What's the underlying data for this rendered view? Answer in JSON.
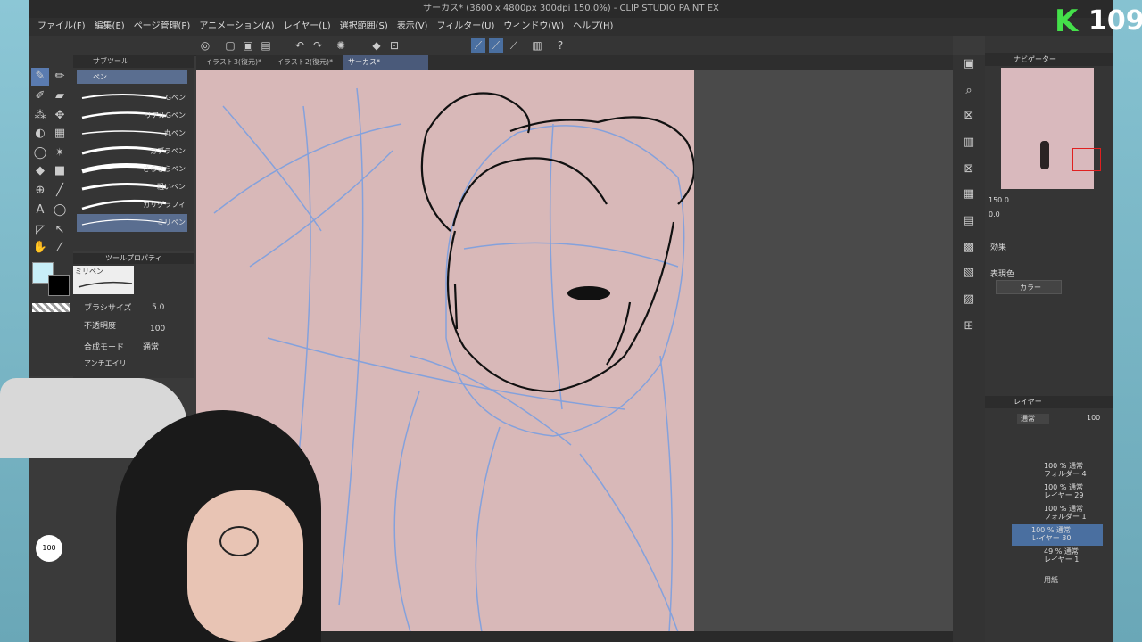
{
  "window": {
    "title": "サーカス* (3600 x 4800px 300dpi 150.0%)  - CLIP STUDIO PAINT EX"
  },
  "menu": [
    "ファイル(F)",
    "編集(E)",
    "ページ管理(P)",
    "アニメーション(A)",
    "レイヤー(L)",
    "選択範囲(S)",
    "表示(V)",
    "フィルター(U)",
    "ウィンドウ(W)",
    "ヘルプ(H)"
  ],
  "tabs": [
    {
      "label": "イラスト3(復元)*"
    },
    {
      "label": "イラスト2(復元)*"
    },
    {
      "label": "サーカス*",
      "active": true
    }
  ],
  "subtool": {
    "header": "サブツール",
    "group": "ペン",
    "brushes": [
      "Gペン",
      "リアルGペン",
      "丸ペン",
      "カブラペン",
      "さらさらペン",
      "粗いペン",
      "カリグラフィ",
      "ミリペン"
    ],
    "selected": "ミリペン"
  },
  "toolprop": {
    "header": "ツールプロパティ",
    "brush_name": "ミリペン",
    "brush_size_label": "ブラシサイズ",
    "brush_size": "5.0",
    "opacity_label": "不透明度",
    "opacity": "100",
    "blend_label": "合成モード",
    "blend": "通常",
    "aa_label": "アンチエイリ"
  },
  "navigator": {
    "header": "ナビゲーター",
    "zoom": "150.0",
    "rotate": "0.0"
  },
  "effects": {
    "header": "効果",
    "color_label": "表現色",
    "color_value": "カラー"
  },
  "layers": {
    "header": "レイヤー",
    "blend": "通常",
    "opacity": "100",
    "items": [
      {
        "line1": "100 % 通常",
        "line2": "フォルダー 4"
      },
      {
        "line1": "100 % 通常",
        "line2": "レイヤー 29"
      },
      {
        "line1": "100 % 通常",
        "line2": "フォルダー 1"
      },
      {
        "line1": "100 % 通常",
        "line2": "レイヤー 30",
        "active": true
      },
      {
        "line1": "49 % 通常",
        "line2": "レイヤー 1"
      },
      {
        "line1": "",
        "line2": "用紙"
      }
    ]
  },
  "colors": {
    "main": "#c8eef8",
    "sub": "#000000"
  },
  "webcam_percent": "100",
  "logo": {
    "letter": "K",
    "number": "109"
  }
}
